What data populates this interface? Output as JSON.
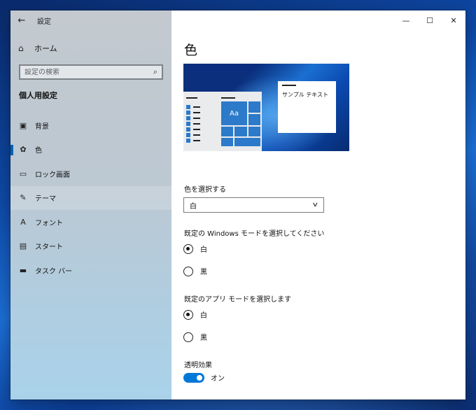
{
  "window": {
    "app_title": "設定",
    "controls": {
      "minimize": "—",
      "maximize": "☐",
      "close": "✕"
    }
  },
  "sidebar": {
    "back_glyph": "←",
    "home_label": "ホーム",
    "search_placeholder": "設定の検索",
    "section_title": "個人用設定",
    "items": [
      {
        "label": "背景",
        "icon": "picture-icon",
        "glyph": "▣"
      },
      {
        "label": "色",
        "icon": "palette-icon",
        "glyph": "✿",
        "selected": true
      },
      {
        "label": "ロック画面",
        "icon": "lock-screen-icon",
        "glyph": "▭"
      },
      {
        "label": "テーマ",
        "icon": "theme-brush-icon",
        "glyph": "✎",
        "hovered": true
      },
      {
        "label": "フォント",
        "icon": "font-icon",
        "glyph": "A"
      },
      {
        "label": "スタート",
        "icon": "start-tiles-icon",
        "glyph": "▤"
      },
      {
        "label": "タスク バー",
        "icon": "taskbar-icon",
        "glyph": "▬"
      }
    ]
  },
  "main": {
    "page_title": "色",
    "preview": {
      "sample_text": "サンプル テキスト",
      "tile_text": "Aa"
    },
    "color_select": {
      "label": "色を選択する",
      "value": "白"
    },
    "windows_mode": {
      "label": "既定の Windows モードを選択してください",
      "options": [
        {
          "label": "白",
          "checked": true
        },
        {
          "label": "黒",
          "checked": false
        }
      ]
    },
    "app_mode": {
      "label": "既定のアプリ モードを選択します",
      "options": [
        {
          "label": "白",
          "checked": true
        },
        {
          "label": "黒",
          "checked": false
        }
      ]
    },
    "transparency": {
      "label": "透明効果",
      "state_label": "オン",
      "on": true
    }
  },
  "colors": {
    "accent": "#0078d7",
    "tile_blue": "#2c7ac9"
  }
}
